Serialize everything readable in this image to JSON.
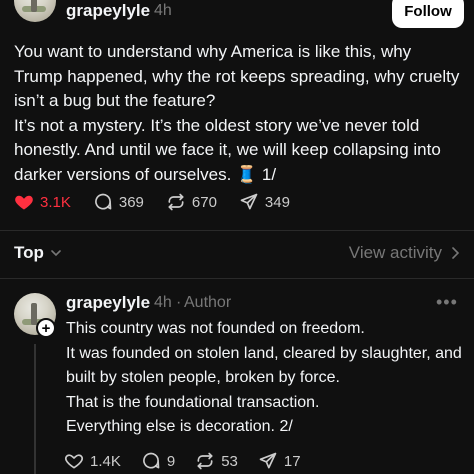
{
  "post": {
    "username": "grapeylyle",
    "time": "4h",
    "follow_label": "Follow",
    "paragraphs": [
      "You want to understand why America is like this, why Trump happened, why the rot keeps spreading, why cruelty isn’t a bug but the feature?",
      "It’s not a mystery. It’s the oldest story we’ve never told honestly. And until we face it, we will keep collapsing into darker versions of ourselves. 🧵 1/"
    ],
    "likes": "3.1K",
    "replies": "369",
    "reposts": "670",
    "shares": "349",
    "liked_color": "#ff3040"
  },
  "sort": {
    "label": "Top",
    "view_activity": "View activity"
  },
  "reply": {
    "username": "grapeylyle",
    "time": "4h",
    "role": "Author",
    "meta_sep": "·",
    "more_label": "•••",
    "plus_label": "+",
    "lines": [
      "This country was not founded on freedom.",
      "It was founded on stolen land, cleared by slaughter, and built by stolen people, broken by force.",
      "That is the foundational transaction.",
      "Everything else is decoration. 2/"
    ],
    "likes": "1.4K",
    "replies": "9",
    "reposts": "53",
    "shares": "17"
  },
  "icons": {
    "like": "heart-icon",
    "reply": "comment-bubble-icon",
    "repost": "repost-icon",
    "share": "send-icon",
    "sort": "chevron-down-icon",
    "view": "chevron-right-icon",
    "more": "more-dots-icon"
  }
}
